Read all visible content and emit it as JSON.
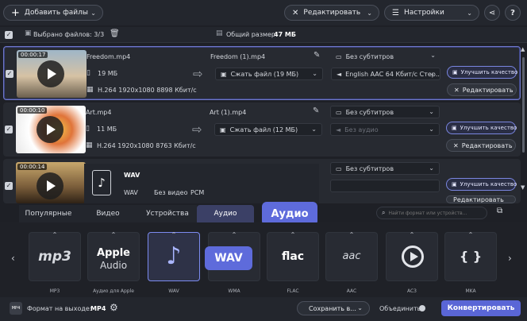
{
  "toolbar": {
    "add_files": "Добавить файлы",
    "edit": "Редактировать",
    "settings": "Настройки"
  },
  "selection": {
    "selected": "Выбрано файлов: 3/3",
    "total_size_label": "Общий размер:",
    "total_size_value": "47 МБ"
  },
  "files": [
    {
      "duration": "00:00:17",
      "name": "Freedom.mp4",
      "size": "19 МБ",
      "codec": "H.264 1920x1080 8898 Кбит/с",
      "output_name": "Freedom (1).mp4",
      "compress": "Сжать файл (19 МБ)",
      "subtitles": "Без субтитров",
      "audio": "English AAC 64 Кбит/с Стер...",
      "enhance": "Улучшить качество",
      "edit": "Редактировать"
    },
    {
      "duration": "00:00:10",
      "name": "Art.mp4",
      "size": "11 МБ",
      "codec": "H.264 1920x1080 8763 Кбит/с",
      "output_name": "Art (1).mp4",
      "compress": "Сжать файл (12 МБ)",
      "subtitles": "Без субтитров",
      "audio": "Без аудио",
      "enhance": "Улучшить качество",
      "edit": "Редактировать"
    },
    {
      "duration": "00:00:14",
      "subtitles": "Без субтитров",
      "enhance": "Улучшить качество",
      "edit": "Редактировать"
    }
  ],
  "wav_card": {
    "title": "WAV",
    "format": "WAV",
    "video": "Без видео",
    "codec": "PCM"
  },
  "tabs": [
    "Популярные",
    "Видео",
    "Устройства",
    "Аудио"
  ],
  "tab_tooltip": "Аудио",
  "search": {
    "placeholder": "Найти формат или устройств..."
  },
  "formats": [
    {
      "logo": "mp3",
      "label": "MP3"
    },
    {
      "logo_line1": "Apple",
      "logo_line2": "Audio",
      "label": "Аудио для Apple"
    },
    {
      "logo": "♪",
      "label": "WAV"
    },
    {
      "logo": "",
      "label": "WMA"
    },
    {
      "logo": "flac",
      "label": "FLAC"
    },
    {
      "logo": "aac",
      "label": "AAC"
    },
    {
      "logo": "",
      "label": "AC3"
    },
    {
      "logo": "{ }",
      "label": "MKA"
    }
  ],
  "format_tooltip": "WAV",
  "bottom": {
    "output_label": "Формат на выходе:",
    "output_value": "MP4",
    "save": "Сохранить в...",
    "merge": "Объединить:",
    "convert": "Конвертировать"
  },
  "colors": {
    "accent": "#5e6bdb",
    "convert_bg": "#5a66d6"
  }
}
